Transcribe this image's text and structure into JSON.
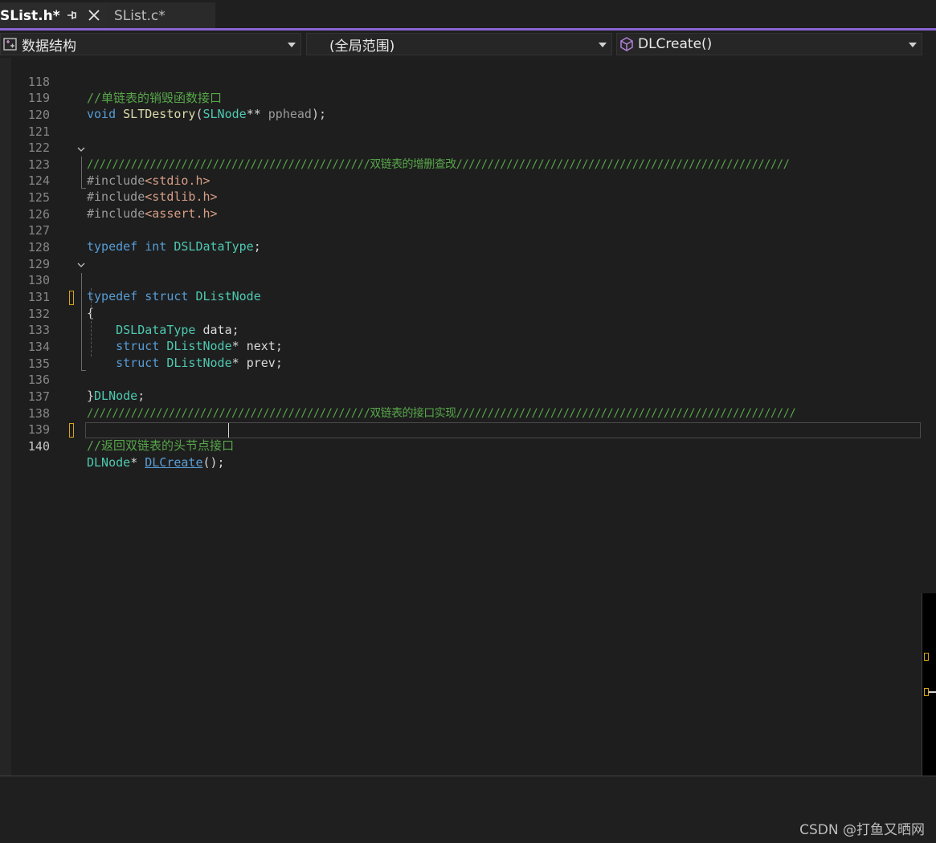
{
  "tabs": [
    {
      "title": "SList.h*",
      "active": true
    },
    {
      "title": "SList.c*",
      "active": false
    }
  ],
  "navbar": {
    "project": "数据结构",
    "scope": "(全局范围)",
    "member": "DLCreate()"
  },
  "lines": {
    "l118": {
      "num": "118",
      "comment": "//单链表的销毁函数接口"
    },
    "l119": {
      "num": "119",
      "kw": "void",
      "func": "SLTDestory",
      "open": "(",
      "type": "SLNode",
      "op": "**",
      "param": "pphead",
      "close": ");"
    },
    "l120": {
      "num": "120"
    },
    "l121": {
      "num": "121"
    },
    "l122": {
      "num": "122",
      "comment": "/////////////////////////////////////////////双链表的增删查改/////////////////////////////////////////////////////"
    },
    "l123": {
      "num": "123",
      "pre": "#include",
      "header": "<stdio.h>"
    },
    "l124": {
      "num": "124",
      "pre": "#include",
      "header": "<stdlib.h>"
    },
    "l125": {
      "num": "125",
      "pre": "#include",
      "header": "<assert.h>"
    },
    "l126": {
      "num": "126"
    },
    "l127": {
      "num": "127",
      "kw": "typedef",
      "kw2": "int",
      "type": "DSLDataType",
      "end": ";"
    },
    "l128": {
      "num": "128"
    },
    "l129": {
      "num": "129"
    },
    "l130": {
      "num": "130",
      "kw": "typedef",
      "kw2": "struct",
      "type": "DListNode"
    },
    "l131": {
      "num": "131",
      "brace": "{"
    },
    "l132": {
      "num": "132",
      "type": "DSLDataType",
      "field": "data",
      "end": ";"
    },
    "l133": {
      "num": "133",
      "kw": "struct",
      "type": "DListNode",
      "op": "*",
      "field": "next",
      "end": ";"
    },
    "l134": {
      "num": "134",
      "kw": "struct",
      "type": "DListNode",
      "op": "*",
      "field": "prev",
      "end": ";"
    },
    "l135": {
      "num": "135"
    },
    "l136": {
      "num": "136",
      "brace": "}",
      "type": "DLNode",
      "end": ";"
    },
    "l137": {
      "num": "137",
      "comment": "/////////////////////////////////////////////双链表的接口实现//////////////////////////////////////////////////////"
    },
    "l138": {
      "num": "138"
    },
    "l139": {
      "num": "139",
      "comment": "//返回双链表的头节点接口"
    },
    "l140": {
      "num": "140",
      "type": "DLNode",
      "op": "*",
      "func": "DLCreate",
      "end": "();"
    }
  },
  "watermark": "CSDN @打鱼又晒网",
  "colors": {
    "accent": "#8a63d2",
    "comment": "#57a64a",
    "keyword": "#569cd6",
    "type": "#4ec9b0",
    "function": "#dcdcaa",
    "string": "#d69d85",
    "change_marker": "#d6a51a"
  }
}
